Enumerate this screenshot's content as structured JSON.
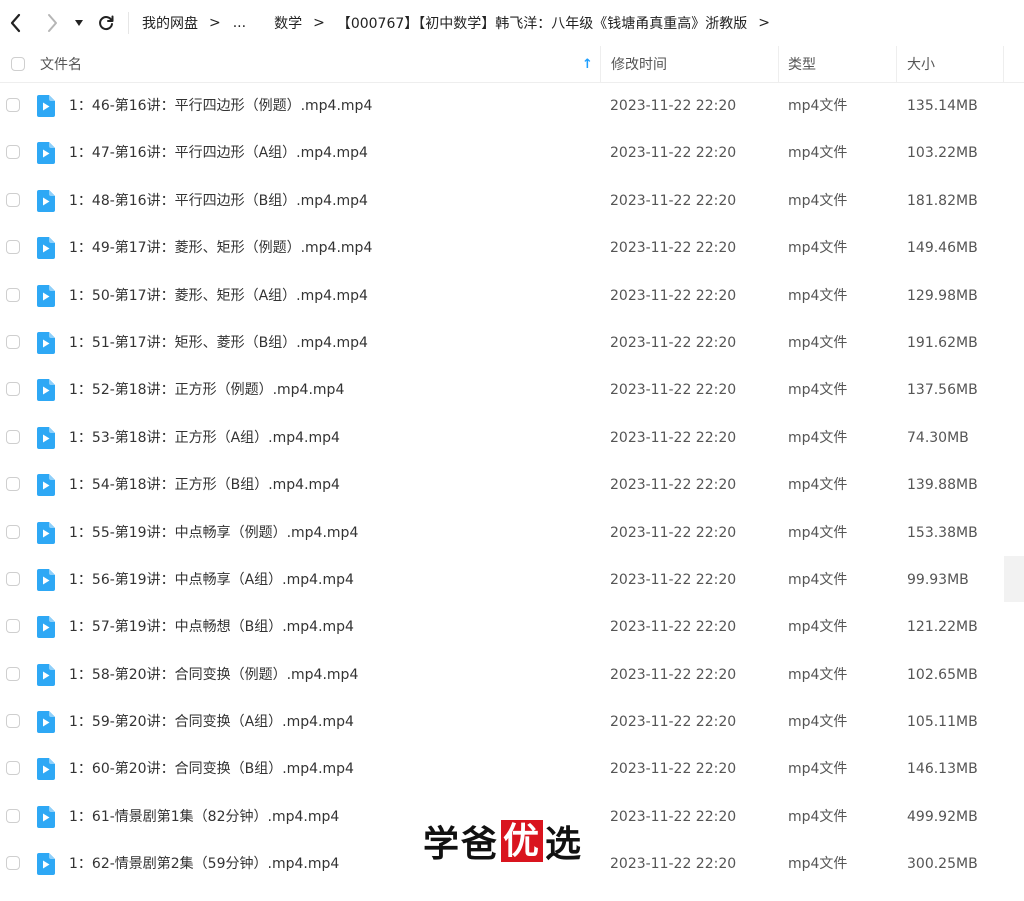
{
  "breadcrumb": [
    {
      "label": "我的网盘"
    },
    {
      "label": "..."
    },
    {
      "label": "数学"
    },
    {
      "label": "【000767】【初中数学】韩飞洋：八年级《钱塘甬真重高》浙教版"
    }
  ],
  "header": {
    "name_label": "文件名",
    "modified_label": "修改时间",
    "type_label": "类型",
    "size_label": "大小",
    "sort_arrow": "↑"
  },
  "files": [
    {
      "name": "1：46-第16讲：平行四边形（例题）.mp4.mp4",
      "modified": "2023-11-22 22:20",
      "type": "mp4文件",
      "size": "135.14MB"
    },
    {
      "name": "1：47-第16讲：平行四边形（A组）.mp4.mp4",
      "modified": "2023-11-22 22:20",
      "type": "mp4文件",
      "size": "103.22MB"
    },
    {
      "name": "1：48-第16讲：平行四边形（B组）.mp4.mp4",
      "modified": "2023-11-22 22:20",
      "type": "mp4文件",
      "size": "181.82MB"
    },
    {
      "name": "1：49-第17讲：菱形、矩形（例题）.mp4.mp4",
      "modified": "2023-11-22 22:20",
      "type": "mp4文件",
      "size": "149.46MB"
    },
    {
      "name": "1：50-第17讲：菱形、矩形（A组）.mp4.mp4",
      "modified": "2023-11-22 22:20",
      "type": "mp4文件",
      "size": "129.98MB"
    },
    {
      "name": "1：51-第17讲：矩形、菱形（B组）.mp4.mp4",
      "modified": "2023-11-22 22:20",
      "type": "mp4文件",
      "size": "191.62MB"
    },
    {
      "name": "1：52-第18讲：正方形（例题）.mp4.mp4",
      "modified": "2023-11-22 22:20",
      "type": "mp4文件",
      "size": "137.56MB"
    },
    {
      "name": "1：53-第18讲：正方形（A组）.mp4.mp4",
      "modified": "2023-11-22 22:20",
      "type": "mp4文件",
      "size": "74.30MB"
    },
    {
      "name": "1：54-第18讲：正方形（B组）.mp4.mp4",
      "modified": "2023-11-22 22:20",
      "type": "mp4文件",
      "size": "139.88MB"
    },
    {
      "name": "1：55-第19讲：中点畅享（例题）.mp4.mp4",
      "modified": "2023-11-22 22:20",
      "type": "mp4文件",
      "size": "153.38MB"
    },
    {
      "name": "1：56-第19讲：中点畅享（A组）.mp4.mp4",
      "modified": "2023-11-22 22:20",
      "type": "mp4文件",
      "size": "99.93MB"
    },
    {
      "name": "1：57-第19讲：中点畅想（B组）.mp4.mp4",
      "modified": "2023-11-22 22:20",
      "type": "mp4文件",
      "size": "121.22MB"
    },
    {
      "name": "1：58-第20讲：合同变换（例题）.mp4.mp4",
      "modified": "2023-11-22 22:20",
      "type": "mp4文件",
      "size": "102.65MB"
    },
    {
      "name": "1：59-第20讲：合同变换（A组）.mp4.mp4",
      "modified": "2023-11-22 22:20",
      "type": "mp4文件",
      "size": "105.11MB"
    },
    {
      "name": "1：60-第20讲：合同变换（B组）.mp4.mp4",
      "modified": "2023-11-22 22:20",
      "type": "mp4文件",
      "size": "146.13MB"
    },
    {
      "name": "1：61-情景剧第1集（82分钟）.mp4.mp4",
      "modified": "2023-11-22 22:20",
      "type": "mp4文件",
      "size": "499.92MB"
    },
    {
      "name": "1：62-情景剧第2集（59分钟）.mp4.mp4",
      "modified": "2023-11-22 22:20",
      "type": "mp4文件",
      "size": "300.25MB"
    }
  ],
  "watermark": {
    "part1": "学爸",
    "badge": "优",
    "part2": "选"
  },
  "colors": {
    "accent": "#1e9fff",
    "icon_blue": "#2ea8f5",
    "watermark_red": "#d9141e"
  },
  "icons": {
    "back": "chevron-left-icon",
    "forward": "chevron-right-icon",
    "history": "caret-down-icon",
    "refresh": "refresh-icon",
    "file": "video-file-icon"
  }
}
